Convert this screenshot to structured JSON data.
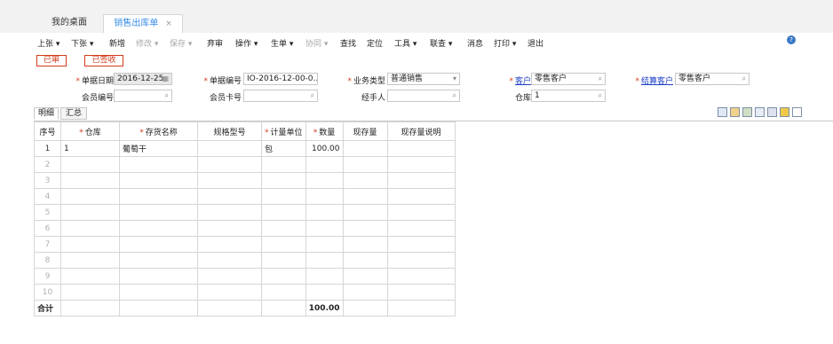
{
  "window_tabs": {
    "home": "我的桌面",
    "active": "销售出库单",
    "close": "×"
  },
  "toolbar": [
    {
      "label": "上张 ▾",
      "disabled": false
    },
    {
      "label": "下张 ▾",
      "disabled": false
    },
    {
      "label": "新增",
      "disabled": false
    },
    {
      "label": "修改 ▾",
      "disabled": true
    },
    {
      "label": "保存 ▾",
      "disabled": true
    },
    {
      "label": "弃审",
      "disabled": false
    },
    {
      "label": "操作 ▾",
      "disabled": false
    },
    {
      "label": "生单 ▾",
      "disabled": false
    },
    {
      "label": "协同 ▾",
      "disabled": true
    },
    {
      "label": "查找",
      "disabled": false
    },
    {
      "label": "定位",
      "disabled": false
    },
    {
      "label": "工具 ▾",
      "disabled": false
    },
    {
      "label": "联查 ▾",
      "disabled": false
    },
    {
      "label": "消息",
      "disabled": false
    },
    {
      "label": "打印 ▾",
      "disabled": false
    },
    {
      "label": "退出",
      "disabled": false
    }
  ],
  "help_icon": "?",
  "status": {
    "audited": "已审",
    "signed": "已签收"
  },
  "form": {
    "date_label": "单据日期",
    "date_value": "2016-12-25",
    "docno_label": "单据编号",
    "docno_value": "IO-2016-12-00-0...",
    "biztype_label": "业务类型",
    "biztype_value": "普通销售",
    "customer_label": "客户",
    "customer_value": "零售客户",
    "settle_label": "结算客户",
    "settle_value": "零售客户",
    "member_no_label": "会员编号",
    "member_no_value": "",
    "member_card_label": "会员卡号",
    "member_card_value": "",
    "handler_label": "经手人",
    "handler_value": "",
    "warehouse_label": "仓库",
    "warehouse_value": "1"
  },
  "subtabs": {
    "detail": "明细",
    "summary": "汇总"
  },
  "grid": {
    "headers": [
      "序号",
      "仓库",
      "存货名称",
      "规格型号",
      "计量单位",
      "数量",
      "现存量",
      "现存量说明"
    ],
    "required": [
      false,
      true,
      true,
      false,
      true,
      true,
      false,
      false
    ],
    "rows": [
      [
        "1",
        "1",
        "葡萄干",
        "",
        "包",
        "100.00",
        "",
        ""
      ],
      [
        "2",
        "",
        "",
        "",
        "",
        "",
        "",
        ""
      ],
      [
        "3",
        "",
        "",
        "",
        "",
        "",
        "",
        ""
      ],
      [
        "4",
        "",
        "",
        "",
        "",
        "",
        "",
        ""
      ],
      [
        "5",
        "",
        "",
        "",
        "",
        "",
        "",
        ""
      ],
      [
        "6",
        "",
        "",
        "",
        "",
        "",
        "",
        ""
      ],
      [
        "7",
        "",
        "",
        "",
        "",
        "",
        "",
        ""
      ],
      [
        "8",
        "",
        "",
        "",
        "",
        "",
        "",
        ""
      ],
      [
        "9",
        "",
        "",
        "",
        "",
        "",
        "",
        ""
      ],
      [
        "10",
        "",
        "",
        "",
        "",
        "",
        "",
        ""
      ]
    ],
    "total_label": "合计",
    "total_qty": "100.00"
  },
  "colors": {
    "accent": "#3a8ee6",
    "stamp": "#d23a1a",
    "link": "#1a3ec8"
  }
}
